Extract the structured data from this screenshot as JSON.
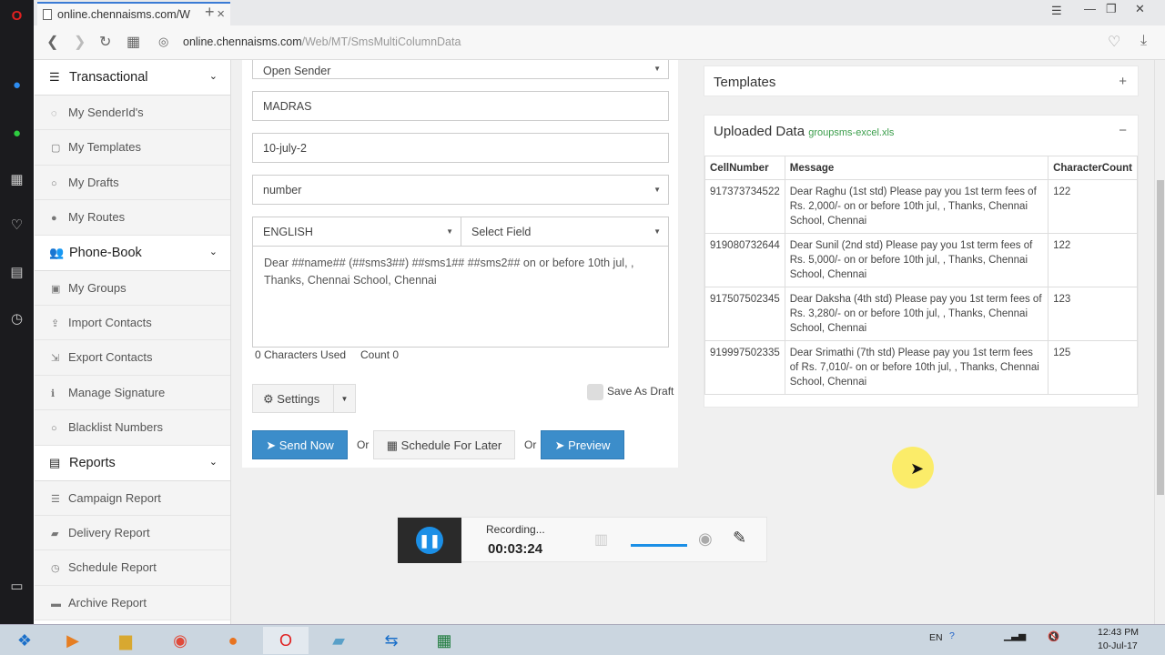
{
  "browser": {
    "tab_title": "online.chennaisms.com/W",
    "new_tab": "+",
    "url_host": "online.chennaisms.com",
    "url_path": "/Web/MT/SmsMultiColumnData",
    "tab_close": "×",
    "win_min": "—",
    "win_max": "❐",
    "win_close": "✕"
  },
  "nav": {
    "transactional": "Transactional",
    "senderids": "My SenderId's",
    "templates": "My Templates",
    "drafts": "My Drafts",
    "routes": "My Routes",
    "phonebook": "Phone-Book",
    "groups": "My Groups",
    "import": "Import Contacts",
    "export": "Export Contacts",
    "signature": "Manage Signature",
    "blacklist": "Blacklist Numbers",
    "reports": "Reports",
    "campaign": "Campaign Report",
    "delivery": "Delivery Report",
    "schedule": "Schedule Report",
    "archive": "Archive Report"
  },
  "form": {
    "sender": "Open Sender",
    "madras": "MADRAS",
    "campaign": "10-july-2",
    "number": "number",
    "language": "ENGLISH",
    "select_field": "Select Field",
    "message": "Dear ##name## (##sms3##) ##sms1## ##sms2## on or before 10th jul,  , Thanks, Chennai School, Chennai",
    "chars_used": "0 Characters Used",
    "count": "Count 0",
    "save_draft": "Save As Draft",
    "settings": "Settings",
    "send_now": "Send Now",
    "or": "Or",
    "schedule": "Schedule For Later",
    "preview": "Preview"
  },
  "templates": {
    "title": "Templates",
    "plus": "+"
  },
  "uploaded": {
    "title": "Uploaded Data",
    "file": "groupsms-excel.xls",
    "minus": "−",
    "headers": [
      "CellNumber",
      "Message",
      "CharacterCount"
    ],
    "rows": [
      {
        "cell": "917373734522",
        "msg": "Dear Raghu (1st std) Please pay you 1st term fees of Rs. 2,000/- on or before 10th jul, , Thanks, Chennai School, Chennai",
        "count": "122"
      },
      {
        "cell": "919080732644",
        "msg": "Dear Sunil (2nd std) Please pay you 1st term fees of Rs. 5,000/- on or before 10th jul, , Thanks, Chennai School, Chennai",
        "count": "122"
      },
      {
        "cell": "917507502345",
        "msg": "Dear Daksha (4th std) Please pay you 1st term fees of Rs. 3,280/- on or before 10th jul, , Thanks, Chennai School, Chennai",
        "count": "123"
      },
      {
        "cell": "919997502335",
        "msg": "Dear Srimathi (7th std) Please pay you 1st term fees of Rs. 7,010/- on or before 10th jul, , Thanks, Chennai School, Chennai",
        "count": "125"
      }
    ]
  },
  "recorder": {
    "status": "Recording...",
    "time": "00:03:24"
  },
  "taskbar": {
    "lang": "EN",
    "time": "12:43 PM",
    "date": "10-Jul-17"
  },
  "colors": {
    "accent": "#3c8dca",
    "file_green": "#3a9d4a"
  }
}
